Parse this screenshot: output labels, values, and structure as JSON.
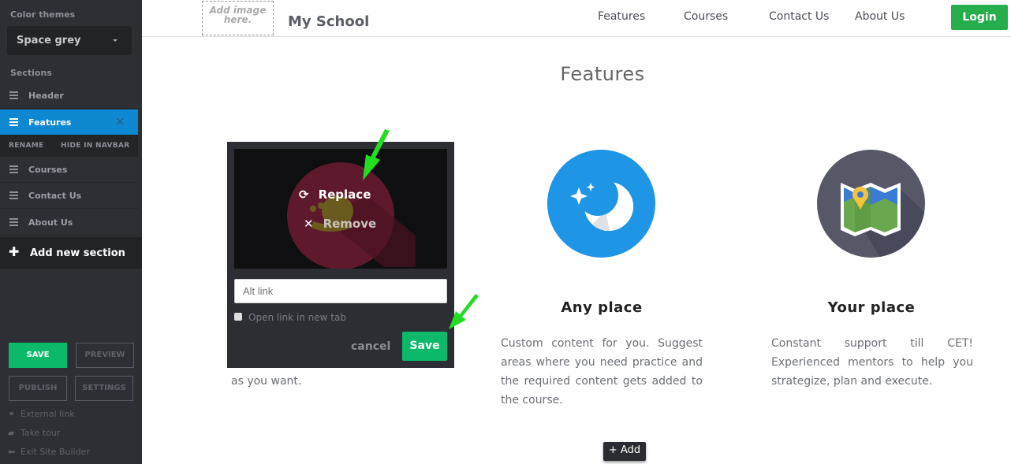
{
  "sidebar": {
    "color_themes_label": "Color themes",
    "theme_selected": "Space grey",
    "sections_label": "Sections",
    "sections": [
      {
        "label": "Header",
        "active": false
      },
      {
        "label": "Features",
        "active": true
      },
      {
        "label": "Courses",
        "active": false
      },
      {
        "label": "Contact Us",
        "active": false
      },
      {
        "label": "About Us",
        "active": false
      }
    ],
    "active_actions": {
      "rename": "RENAME",
      "hide": "HIDE IN NAVBAR"
    },
    "add_section": "Add new section",
    "buttons": {
      "save": "SAVE",
      "preview": "PREVIEW",
      "publish": "PUBLISH",
      "settings": "SETTINGS"
    },
    "links": {
      "external": "External link",
      "tour": "Take tour",
      "exit": "Exit Site Builder"
    }
  },
  "navbar": {
    "logo_placeholder": "Add image here.",
    "brand": "My School",
    "links": [
      "Features",
      "Courses",
      "Contact Us",
      "About Us"
    ],
    "login": "Login"
  },
  "section": {
    "title": "Features",
    "features": [
      {
        "title": "",
        "desc_visible": "as you want.",
        "icon": "snail-icon"
      },
      {
        "title": "Any place",
        "desc": "Custom content for you. Suggest areas where you need practice and the required content gets added to the course.",
        "icon": "moon-stars-icon"
      },
      {
        "title": "Your place",
        "desc": "Constant support till CET! Experienced mentors to help you strategize, plan and execute.",
        "icon": "map-icon"
      }
    ],
    "add_button": "+ Add"
  },
  "image_popup": {
    "replace": "Replace",
    "remove": "Remove",
    "alt_placeholder": "Alt link",
    "alt_value": "",
    "new_tab_label": "Open link in new tab",
    "new_tab_checked": false,
    "cancel": "cancel",
    "save": "Save"
  },
  "colors": {
    "sidebar_bg": "#2e2f34",
    "active_section": "#0e88d0",
    "save_green": "#0cb96b",
    "login_green": "#27ae4c",
    "annotation_arrow": "#22dd22"
  }
}
